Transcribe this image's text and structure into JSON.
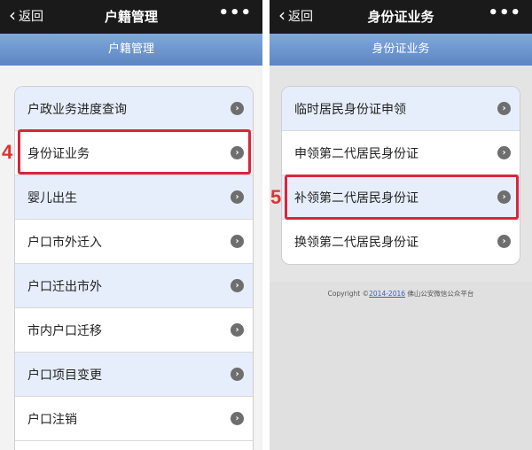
{
  "left": {
    "back_label": "返回",
    "title": "户籍管理",
    "more": "•••",
    "subtitle": "户籍管理",
    "items": [
      {
        "label": "户政业务进度查询"
      },
      {
        "label": "身份证业务"
      },
      {
        "label": "婴儿出生"
      },
      {
        "label": "户口市外迁入"
      },
      {
        "label": "户口迁出市外"
      },
      {
        "label": "市内户口迁移"
      },
      {
        "label": "户口项目变更"
      },
      {
        "label": "户口注销"
      }
    ],
    "step_number": "4",
    "highlighted_item": "身份证业务"
  },
  "right": {
    "back_label": "返回",
    "title": "身份证业务",
    "more": "•••",
    "subtitle": "身份证业务",
    "items": [
      {
        "label": "临时居民身份证申领"
      },
      {
        "label": "申领第二代居民身份证"
      },
      {
        "label": "补领第二代居民身份证"
      },
      {
        "label": "换领第二代居民身份证"
      }
    ],
    "step_number": "5",
    "highlighted_item": "补领第二代居民身份证",
    "footer": {
      "prefix": "Copyright ©",
      "years": "2014-2016",
      "owner": "佛山公安微信公众平台"
    }
  },
  "colors": {
    "highlight": "#d7263d",
    "step": "#e0322f",
    "subbar": "#6e95cf",
    "row_alt": "#e6eefb"
  },
  "icons": {
    "back": "chevron-left-icon",
    "row_arrow": "chevron-right-circle-icon",
    "more": "more-dots-icon"
  }
}
